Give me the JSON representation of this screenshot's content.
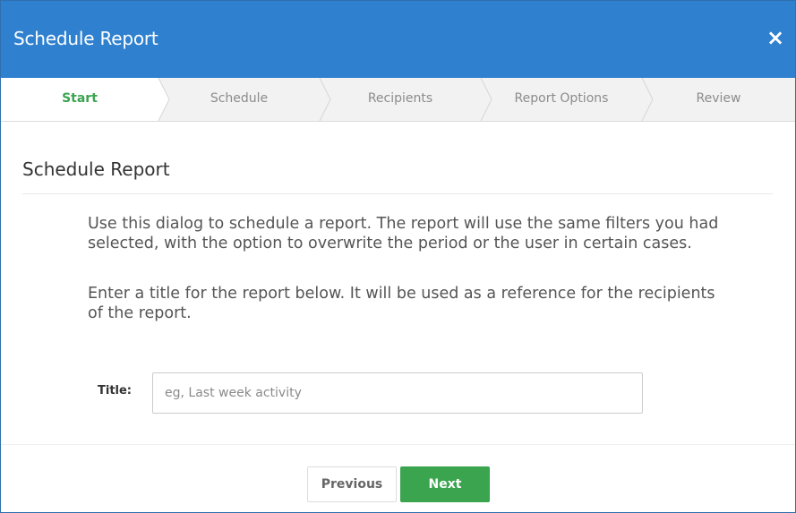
{
  "dialog": {
    "title": "Schedule Report",
    "close_label": "×"
  },
  "steps": [
    {
      "label": "Start",
      "active": true
    },
    {
      "label": "Schedule",
      "active": false
    },
    {
      "label": "Recipients",
      "active": false
    },
    {
      "label": "Report Options",
      "active": false
    },
    {
      "label": "Review",
      "active": false
    }
  ],
  "content": {
    "section_title": "Schedule Report",
    "description": "Use this dialog to schedule a report. The report will use the same filters you had selected, with the option to overwrite the period or the user in certain cases.",
    "instruction": "Enter a title for the report below. It will be used as a reference for the recipients of the report.",
    "title_field": {
      "label": "Title:",
      "value": "",
      "placeholder": "eg, Last week activity"
    }
  },
  "footer": {
    "previous_label": "Previous",
    "next_label": "Next"
  },
  "colors": {
    "header_bg": "#2f81d0",
    "active_step": "#3aa44f",
    "next_button": "#3aa44f"
  }
}
